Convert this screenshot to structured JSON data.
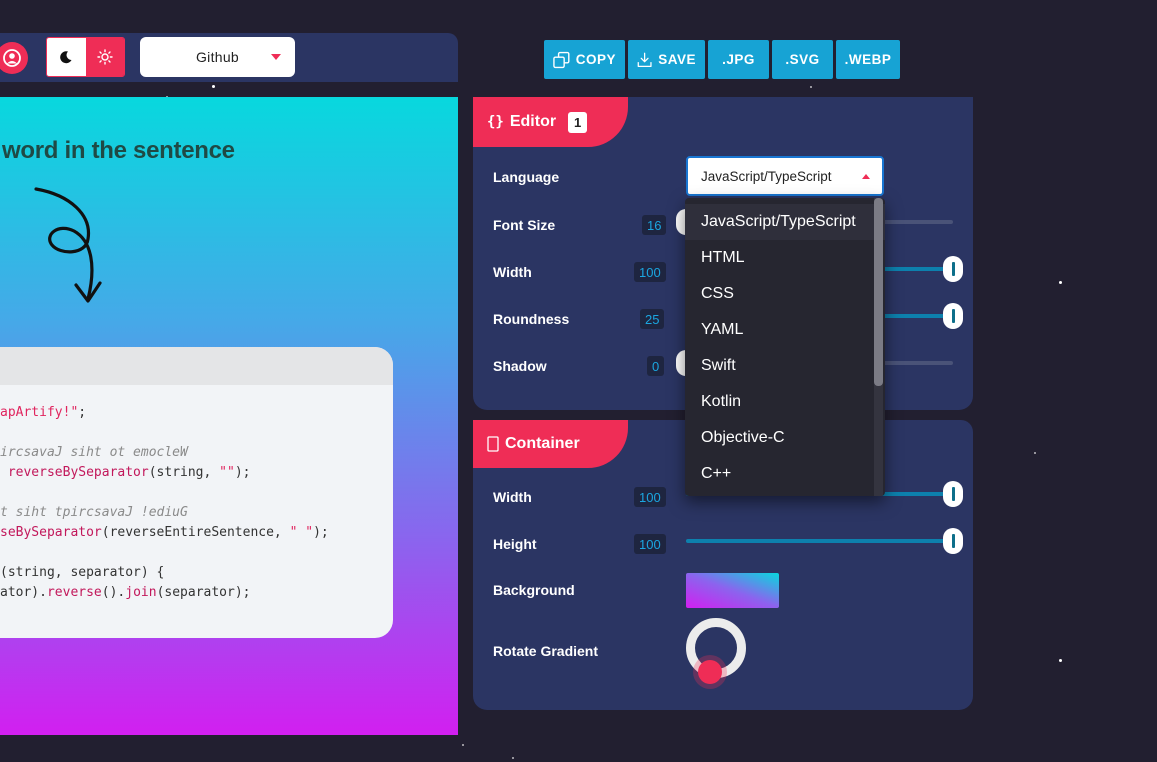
{
  "toolbar": {
    "theme_select_value": "Github"
  },
  "canvas": {
    "title": "word in the sentence",
    "code_lines": [
      [
        {
          "t": "apArtify!\"",
          "k": "str"
        },
        {
          "t": ";",
          "k": "plain"
        }
      ],
      [
        {
          "t": "",
          "k": "plain"
        }
      ],
      [
        {
          "t": "ircsavaJ siht ot emocleW",
          "k": "com"
        }
      ],
      [
        {
          "t": " ",
          "k": "plain"
        },
        {
          "t": "reverseBySeparator",
          "k": "fn"
        },
        {
          "t": "(string, ",
          "k": "plain"
        },
        {
          "t": "\"\"",
          "k": "str"
        },
        {
          "t": ");",
          "k": "plain"
        }
      ],
      [
        {
          "t": "",
          "k": "plain"
        }
      ],
      [
        {
          "t": "t siht tpircsavaJ !ediuG",
          "k": "com"
        }
      ],
      [
        {
          "t": "seBySeparator",
          "k": "fn"
        },
        {
          "t": "(reverseEntireSentence, ",
          "k": "plain"
        },
        {
          "t": "\" \"",
          "k": "str"
        },
        {
          "t": ");",
          "k": "plain"
        }
      ],
      [
        {
          "t": "",
          "k": "plain"
        }
      ],
      [
        {
          "t": "(string, separator) {",
          "k": "plain"
        }
      ],
      [
        {
          "t": "ator).",
          "k": "plain"
        },
        {
          "t": "reverse",
          "k": "fn"
        },
        {
          "t": "().",
          "k": "plain"
        },
        {
          "t": "join",
          "k": "fn"
        },
        {
          "t": "(separator);",
          "k": "plain"
        }
      ]
    ]
  },
  "export": {
    "copy": "COPY",
    "save": "SAVE",
    "jpg": ".JPG",
    "svg": ".SVG",
    "webp": ".WEBP"
  },
  "editor": {
    "tab_label": "Editor",
    "tab_badge": "1",
    "language_label": "Language",
    "language_value": "JavaScript/TypeScript",
    "font_size_label": "Font Size",
    "font_size_value": "16",
    "width_label": "Width",
    "width_value": "100",
    "roundness_label": "Roundness",
    "roundness_value": "25",
    "shadow_label": "Shadow",
    "shadow_value": "0"
  },
  "container": {
    "tab_label": "Container",
    "width_label": "Width",
    "width_value": "100",
    "height_label": "Height",
    "height_value": "100",
    "background_label": "Background",
    "rotate_label": "Rotate Gradient"
  },
  "language_options": [
    "JavaScript/TypeScript",
    "HTML",
    "CSS",
    "YAML",
    "Swift",
    "Kotlin",
    "Objective-C",
    "C++"
  ],
  "colors": {
    "accent": "#ef2d56",
    "panel": "#2b3563",
    "export_button": "#17a3d4",
    "slider": "#0d80ad"
  }
}
